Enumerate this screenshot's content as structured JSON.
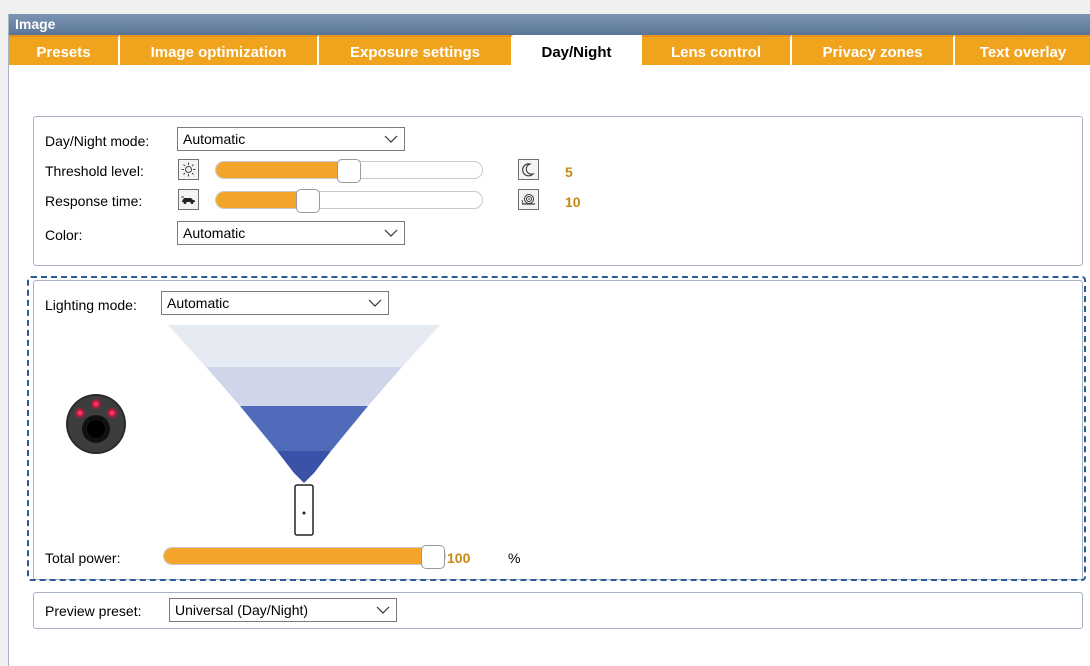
{
  "window": {
    "title": "Image"
  },
  "tabs": [
    {
      "label": "Presets"
    },
    {
      "label": "Image optimization"
    },
    {
      "label": "Exposure settings"
    },
    {
      "label": "Day/Night"
    },
    {
      "label": "Lens control"
    },
    {
      "label": "Privacy zones"
    },
    {
      "label": "Text overlay"
    }
  ],
  "daynight": {
    "mode_label": "Day/Night mode:",
    "mode_value": "Automatic",
    "threshold_label": "Threshold level:",
    "threshold_value": "5",
    "threshold_fraction": 0.5,
    "response_label": "Response time:",
    "response_value": "10",
    "response_fraction": 0.33,
    "color_label": "Color:",
    "color_value": "Automatic"
  },
  "lighting": {
    "mode_label": "Lighting mode:",
    "mode_value": "Automatic",
    "power_label": "Total power:",
    "power_value": "100",
    "power_unit": "%",
    "power_fraction": 1.0
  },
  "preview": {
    "label": "Preview preset:",
    "value": "Universal (Day/Night)"
  },
  "icons": {
    "threshold_low": "sun-icon",
    "threshold_high": "moon-icon",
    "response_fast": "car-icon",
    "response_slow": "snail-icon"
  },
  "colors": {
    "accent": "#f2a52a",
    "value_text": "#c58a14",
    "header": "#6682a4",
    "dashed_border": "#2a5c9a"
  }
}
